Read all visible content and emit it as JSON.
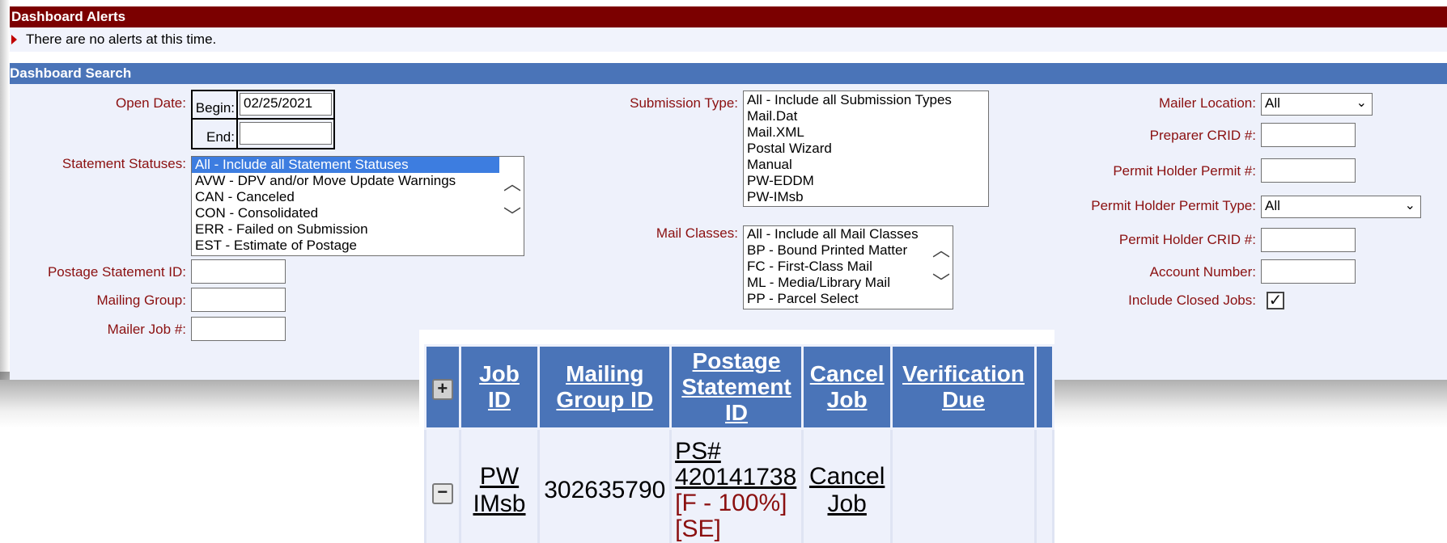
{
  "alerts": {
    "title": "Dashboard Alerts",
    "message": "There are no alerts at this time."
  },
  "search": {
    "title": "Dashboard Search",
    "open_date": {
      "label": "Open Date:",
      "begin_label": "Begin:",
      "begin_value": "02/25/2021",
      "end_label": "End:",
      "end_value": ""
    },
    "statement_statuses": {
      "label": "Statement Statuses:",
      "options": [
        "All - Include all Statement Statuses",
        "AVW - DPV and/or Move Update Warnings",
        "CAN - Canceled",
        "CON - Consolidated",
        "ERR - Failed on Submission",
        "EST - Estimate of Postage"
      ],
      "selected": "All - Include all Statement Statuses"
    },
    "postage_statement_id": {
      "label": "Postage Statement ID:",
      "value": ""
    },
    "mailing_group": {
      "label": "Mailing Group:",
      "value": ""
    },
    "mailer_job": {
      "label": "Mailer Job #:",
      "value": ""
    },
    "submission_type": {
      "label": "Submission Type:",
      "options": [
        "All - Include all Submission Types",
        "Mail.Dat",
        "Mail.XML",
        "Postal Wizard",
        "Manual",
        "PW-EDDM",
        "PW-IMsb"
      ]
    },
    "mail_classes": {
      "label": "Mail Classes:",
      "options": [
        "All - Include all Mail Classes",
        "BP - Bound Printed Matter",
        "FC - First-Class Mail",
        "ML - Media/Library Mail",
        "PP - Parcel Select"
      ]
    },
    "mailer_location": {
      "label": "Mailer Location:",
      "value": "All"
    },
    "preparer_crid": {
      "label": "Preparer CRID #:",
      "value": ""
    },
    "permit_holder_permit": {
      "label": "Permit Holder Permit #:",
      "value": ""
    },
    "permit_holder_permit_type": {
      "label": "Permit Holder Permit Type:",
      "value": "All"
    },
    "permit_holder_crid": {
      "label": "Permit Holder CRID #:",
      "value": ""
    },
    "account_number": {
      "label": "Account Number:",
      "value": ""
    },
    "include_closed_jobs": {
      "label": "Include Closed Jobs:",
      "checked": true,
      "mark": "✓"
    }
  },
  "results": {
    "headers": {
      "expand": "+",
      "job_id_1": "Job",
      "job_id_2": "ID",
      "mailing_group_1": "Mailing",
      "mailing_group_2": "Group ID",
      "postage_1": "Postage",
      "postage_2": "Statement",
      "postage_3": "ID",
      "cancel_1": "Cancel",
      "cancel_2": "Job",
      "verification_1": "Verification",
      "verification_2": "Due"
    },
    "row": {
      "collapse": "−",
      "job_id_1": "PW",
      "job_id_2": "IMsb",
      "mailing_group_id": "302635790",
      "ps_1": "PS#",
      "ps_2": "420141738",
      "ps_status": "[F - 100%]",
      "ps_flag": "[SE]",
      "cancel_1": "Cancel",
      "cancel_2": "Job",
      "verification_due": ""
    }
  }
}
